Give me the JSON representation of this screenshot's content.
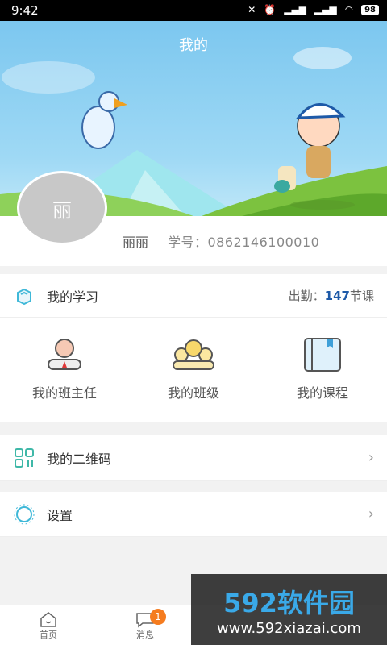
{
  "status": {
    "time": "9:42",
    "battery": "98"
  },
  "header": {
    "title": "我的"
  },
  "profile": {
    "avatar_char": "丽",
    "name": "丽丽",
    "student_id": "学号：0862146100010"
  },
  "study": {
    "label": "我的学习",
    "attendance_prefix": "出勤：",
    "attendance_count": "147",
    "attendance_suffix": "节课"
  },
  "grid": [
    {
      "label": "我的班主任"
    },
    {
      "label": "我的班级"
    },
    {
      "label": "我的课程"
    }
  ],
  "qr": {
    "label": "我的二维码"
  },
  "settings": {
    "label": "设置"
  },
  "tabs": [
    {
      "label": "首页"
    },
    {
      "label": "消息",
      "badge": "1"
    }
  ],
  "watermark": {
    "title": "592软件园",
    "url": "www.592xiazai.com"
  }
}
